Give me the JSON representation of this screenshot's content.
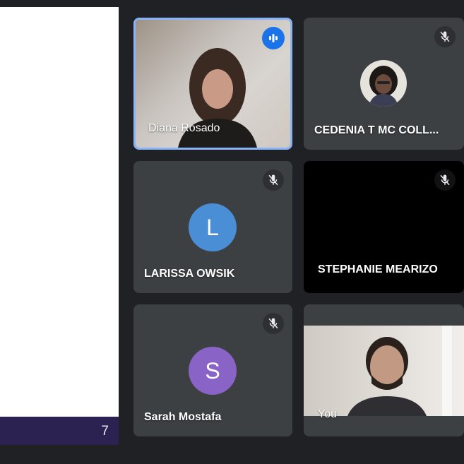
{
  "presentation": {
    "page_number": "7"
  },
  "participants": [
    {
      "name": "Diana Rosado",
      "state": "speaking"
    },
    {
      "name": "CEDENIA T MC COLL...",
      "state": "muted"
    },
    {
      "name": "LARISSA OWSIK",
      "state": "muted",
      "avatar_letter": "L",
      "avatar_color": "#4a8fd6"
    },
    {
      "name": "STEPHANIE MEARIZO",
      "state": "muted"
    },
    {
      "name": "Sarah Mostafa",
      "state": "muted",
      "avatar_letter": "S",
      "avatar_color": "#8a63c7"
    },
    {
      "name": "You",
      "state": "self"
    }
  ],
  "colors": {
    "background": "#202124",
    "tile": "#3c4043",
    "speaking_accent": "#1a73e8",
    "active_border": "#8ab4f8"
  }
}
